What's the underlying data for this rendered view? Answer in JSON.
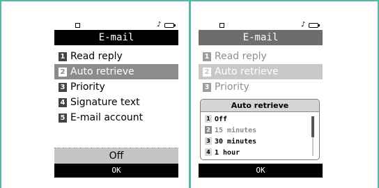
{
  "left_screen": {
    "title": "E-mail",
    "menu": [
      {
        "num": "1",
        "label": "Read reply"
      },
      {
        "num": "2",
        "label": "Auto retrieve"
      },
      {
        "num": "3",
        "label": "Priority"
      },
      {
        "num": "4",
        "label": "Signature text"
      },
      {
        "num": "5",
        "label": "E-mail account"
      }
    ],
    "selected_index": 1,
    "value": "Off",
    "softkey": "OK"
  },
  "right_screen": {
    "title": "E-mail",
    "menu": [
      {
        "num": "1",
        "label": "Read reply"
      },
      {
        "num": "2",
        "label": "Auto retrieve"
      },
      {
        "num": "3",
        "label": "Priority"
      }
    ],
    "selected_index": 1,
    "popup": {
      "title": "Auto retrieve",
      "options": [
        {
          "num": "1",
          "label": "Off"
        },
        {
          "num": "2",
          "label": "15 minutes"
        },
        {
          "num": "3",
          "label": "30 minutes"
        },
        {
          "num": "4",
          "label": "1 hour"
        }
      ]
    },
    "softkey": "OK"
  },
  "status_icons": [
    "signal-icon",
    "music-note-icon",
    "battery-icon"
  ],
  "colors": {
    "frame": "#52b8a8",
    "selection": "#8c8c8c",
    "titlebar": "#000000"
  }
}
